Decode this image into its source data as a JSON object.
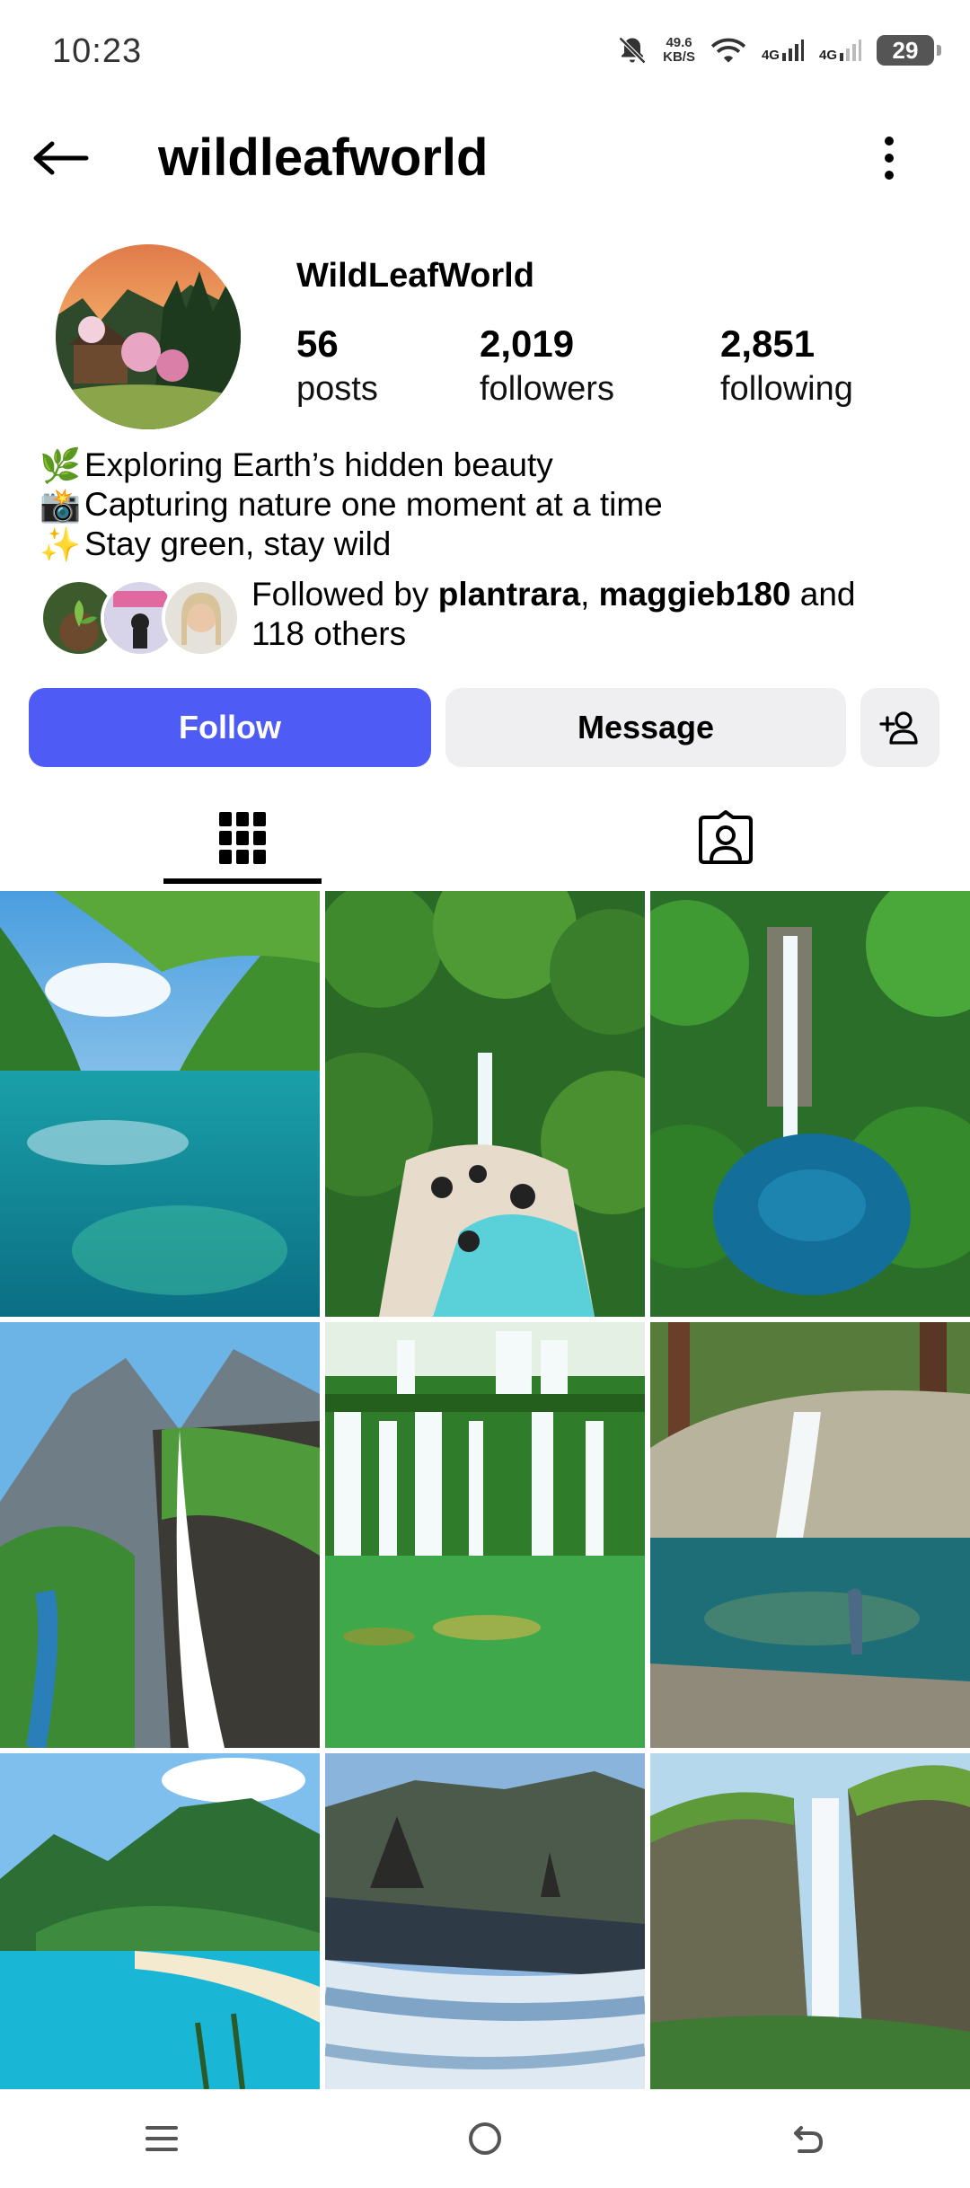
{
  "status_bar": {
    "time": "10:23",
    "net_speed_value": "49.6",
    "net_speed_unit": "KB/S",
    "network_1": "4G",
    "network_2": "4G",
    "battery": "29"
  },
  "header": {
    "username": "wildleafworld"
  },
  "profile": {
    "display_name": "WildLeafWorld",
    "stats": [
      {
        "value": "56",
        "label": "posts"
      },
      {
        "value": "2,019",
        "label": "followers"
      },
      {
        "value": "2,851",
        "label": "following"
      }
    ],
    "bio": [
      {
        "emoji": "🌿",
        "text": "Exploring Earth’s hidden beauty"
      },
      {
        "emoji": "📸",
        "text": "Capturing nature one moment at a time"
      },
      {
        "emoji": "✨",
        "text": "Stay green, stay wild"
      }
    ],
    "followed_by_prefix": "Followed by",
    "followed_by_user1": "plantrara",
    "followed_by_sep": ",",
    "followed_by_user2": "maggieb180",
    "followed_by_and": "and",
    "followed_by_others": "118 others"
  },
  "actions": {
    "follow": "Follow",
    "message": "Message"
  },
  "colors": {
    "follow_button": "#4f5bf5",
    "secondary_button": "#efeff1"
  }
}
